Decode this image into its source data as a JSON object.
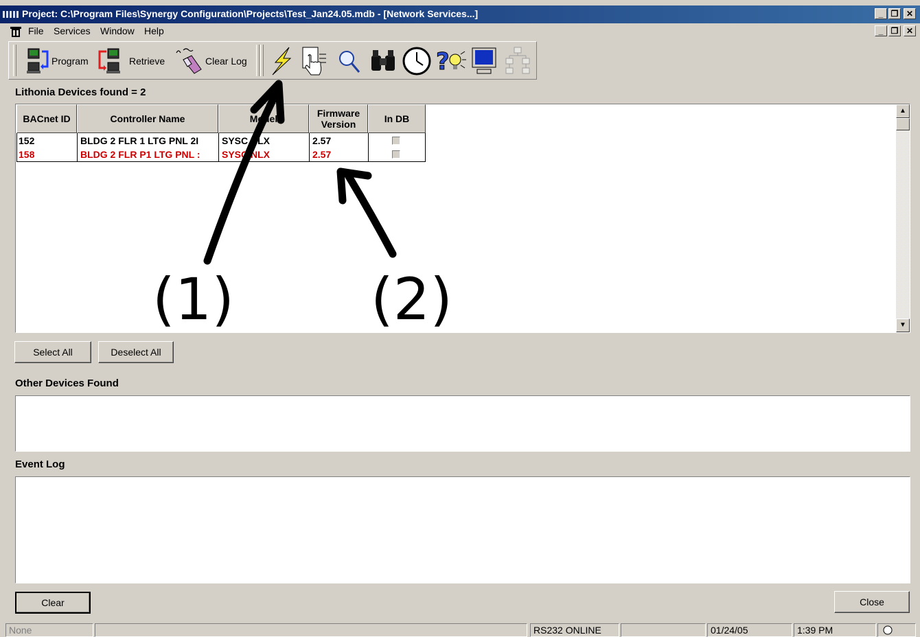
{
  "window": {
    "title": "Project: C:\\Program Files\\Synergy Configuration\\Projects\\Test_Jan24.05.mdb - [Network Services...]"
  },
  "menu": [
    "File",
    "Services",
    "Window",
    "Help"
  ],
  "toolbar": {
    "program_label": "Program",
    "retrieve_label": "Retrieve",
    "clear_log_label": "Clear Log",
    "icons": [
      "lightning-icon",
      "hand-pointer-icon",
      "magnifier-icon",
      "binoculars-icon",
      "clock-icon",
      "help-icon",
      "monitor-icon",
      "network-icon"
    ]
  },
  "devices": {
    "found_label": "Lithonia Devices found = 2",
    "columns": [
      "BACnet ID",
      "Controller Name",
      "Model",
      "Firmware Version",
      "In DB"
    ],
    "rows": [
      {
        "bacnet_id": "152",
        "controller_name": "BLDG 2 FLR 1 LTG PNL 2I",
        "model": "SYSC NLX",
        "firmware": "2.57",
        "color": "#000000"
      },
      {
        "bacnet_id": "158",
        "controller_name": "BLDG 2 FLR P1 LTG PNL :",
        "model": "SYSC NLX",
        "firmware": "2.57",
        "color": "#cc0000"
      }
    ]
  },
  "buttons": {
    "select_all": "Select All",
    "deselect_all": "Deselect All",
    "clear": "Clear",
    "close": "Close"
  },
  "other_devices": {
    "label": "Other Devices Found"
  },
  "event_log": {
    "label": "Event Log"
  },
  "status_bar": {
    "state": "None",
    "connection": "RS232 ONLINE",
    "date": "01/24/05",
    "time": "1:39 PM"
  },
  "annotations": {
    "label_1": "(1)",
    "label_2": "(2)"
  }
}
